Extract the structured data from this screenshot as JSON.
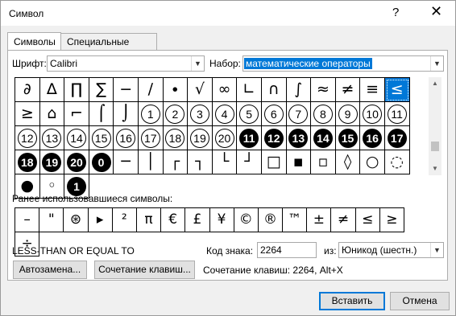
{
  "window": {
    "title": "Символ",
    "help_label": "?",
    "close_label": "✕"
  },
  "tabs": [
    {
      "label": "Символы",
      "active": true
    },
    {
      "label": "Специальные знаки",
      "active": false
    }
  ],
  "font": {
    "label": "Шрифт:",
    "value": "Calibri"
  },
  "subset": {
    "label": "Набор:",
    "value": "математические операторы"
  },
  "symbol_grid": {
    "rows": [
      [
        {
          "text": "∂"
        },
        {
          "text": "∆"
        },
        {
          "text": "∏"
        },
        {
          "text": "∑"
        },
        {
          "text": "−"
        },
        {
          "text": "∕"
        },
        {
          "text": "∙"
        },
        {
          "text": "√"
        },
        {
          "text": "∞"
        },
        {
          "text": "∟"
        },
        {
          "text": "∩"
        },
        {
          "text": "∫"
        },
        {
          "text": "≈"
        },
        {
          "text": "≠"
        },
        {
          "text": "≡"
        },
        {
          "text": "≤",
          "selected": true
        },
        {
          "text": "≥"
        }
      ],
      [
        {
          "text": "⌂"
        },
        {
          "text": "⌐"
        },
        {
          "text": "⌠"
        },
        {
          "text": "⌡"
        },
        {
          "text": "1",
          "style": "circle"
        },
        {
          "text": "2",
          "style": "circle"
        },
        {
          "text": "3",
          "style": "circle"
        },
        {
          "text": "4",
          "style": "circle"
        },
        {
          "text": "5",
          "style": "circle"
        },
        {
          "text": "6",
          "style": "circle"
        },
        {
          "text": "7",
          "style": "circle"
        },
        {
          "text": "8",
          "style": "circle"
        },
        {
          "text": "9",
          "style": "circle"
        },
        {
          "text": "10",
          "style": "circle"
        },
        {
          "text": "11",
          "style": "circle"
        },
        {
          "text": "12",
          "style": "circle"
        },
        {
          "text": "13",
          "style": "circle"
        }
      ],
      [
        {
          "text": "14",
          "style": "circle"
        },
        {
          "text": "15",
          "style": "circle"
        },
        {
          "text": "16",
          "style": "circle"
        },
        {
          "text": "17",
          "style": "circle"
        },
        {
          "text": "18",
          "style": "circle"
        },
        {
          "text": "19",
          "style": "circle"
        },
        {
          "text": "20",
          "style": "circle"
        },
        {
          "text": "11",
          "style": "filled"
        },
        {
          "text": "12",
          "style": "filled"
        },
        {
          "text": "13",
          "style": "filled"
        },
        {
          "text": "14",
          "style": "filled"
        },
        {
          "text": "15",
          "style": "filled"
        },
        {
          "text": "16",
          "style": "filled"
        },
        {
          "text": "17",
          "style": "filled"
        },
        {
          "text": "18",
          "style": "filled"
        },
        {
          "text": "19",
          "style": "filled"
        }
      ],
      [
        {
          "text": "20",
          "style": "filled"
        },
        {
          "text": "0",
          "style": "filled"
        },
        {
          "text": "─"
        },
        {
          "text": "│"
        },
        {
          "text": "┌"
        },
        {
          "text": "┐"
        },
        {
          "text": "└"
        },
        {
          "text": "┘"
        },
        {
          "text": "□"
        },
        {
          "text": "▪"
        },
        {
          "text": "▫"
        },
        {
          "text": "◊"
        },
        {
          "text": "○"
        },
        {
          "text": "◌"
        },
        {
          "text": "●"
        },
        {
          "text": "◦"
        },
        {
          "text": "1",
          "style": "filled"
        }
      ]
    ]
  },
  "recent": {
    "label": "Ранее использовавшиеся символы:",
    "symbols": [
      "–",
      "\"",
      "⊛",
      "▸",
      "²",
      "π",
      "€",
      "£",
      "¥",
      "©",
      "®",
      "™",
      "±",
      "≠",
      "≤",
      "≥",
      "÷"
    ]
  },
  "char_name": "LESS-THAN OR EQUAL TO",
  "char_code": {
    "label": "Код знака:",
    "value": "2264"
  },
  "from": {
    "label": "из:",
    "value": "Юникод (шестн.)"
  },
  "buttons": {
    "autocorrect": "Автозамена...",
    "shortcut_key": "Сочетание клавиш...",
    "insert": "Вставить",
    "cancel": "Отмена"
  },
  "shortcut_text": "Сочетание клавиш: 2264, Alt+X",
  "colors": {
    "selection": "#0078d7",
    "dialog_bg": "#f0f0f0"
  }
}
